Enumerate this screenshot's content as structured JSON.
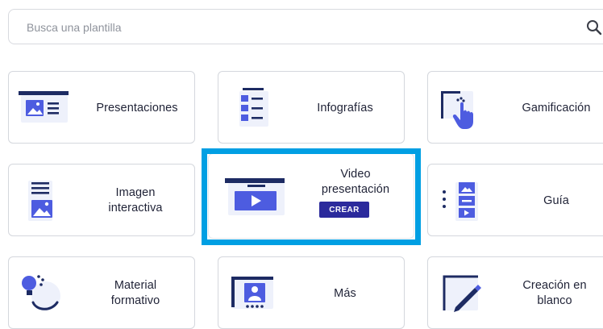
{
  "search": {
    "placeholder": "Busca una plantilla",
    "icon": "search-icon"
  },
  "colors": {
    "accent": "#2b2a9c",
    "icon_navy": "#1d2b63",
    "icon_blue": "#4d5ce0",
    "highlight": "#009fe3"
  },
  "cards": [
    {
      "id": "presentaciones",
      "label": "Presentaciones",
      "icon": "presentation-icon"
    },
    {
      "id": "infografias",
      "label": "Infografías",
      "icon": "infographic-icon"
    },
    {
      "id": "gamificacion",
      "label": "Gamificación",
      "icon": "gamification-icon"
    },
    {
      "id": "imagen-interactiva",
      "label_lines": [
        "Imagen",
        "interactiva"
      ],
      "icon": "interactive-image-icon"
    },
    {
      "id": "video-presentacion",
      "label_lines": [
        "Video",
        "presentación"
      ],
      "icon": "video-presentation-icon",
      "button": "CREAR",
      "selected": true
    },
    {
      "id": "guia",
      "label": "Guía",
      "icon": "guide-icon"
    },
    {
      "id": "material-formativo",
      "label_lines": [
        "Material",
        "formativo"
      ],
      "icon": "training-material-icon"
    },
    {
      "id": "mas",
      "label": "Más",
      "icon": "more-icon"
    },
    {
      "id": "creacion-en-blanco",
      "label_lines": [
        "Creación en",
        "blanco"
      ],
      "icon": "blank-creation-icon"
    }
  ]
}
